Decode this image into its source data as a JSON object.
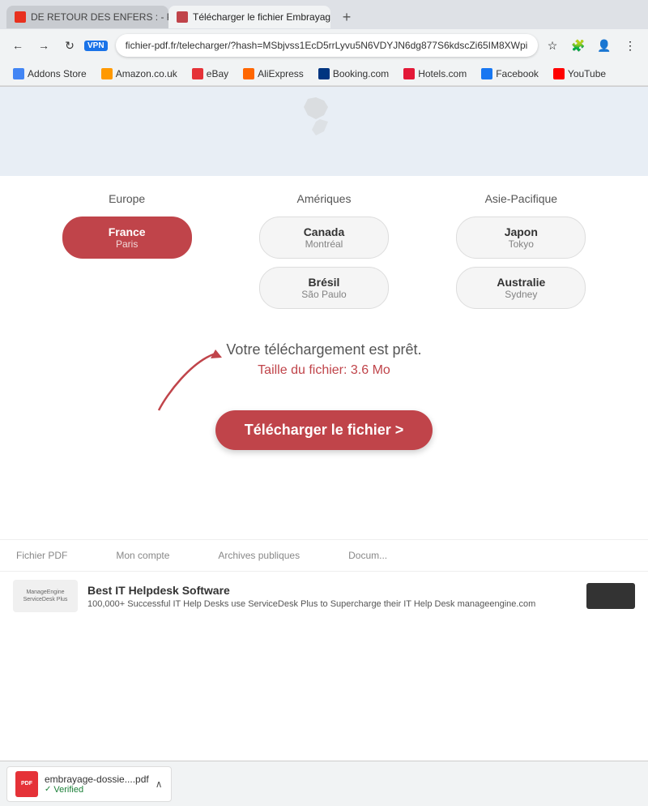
{
  "browser": {
    "tabs": [
      {
        "id": "tab1",
        "title": "DE RETOUR DES ENFERS : - Page...",
        "active": false,
        "favicon_color": "#e8301e"
      },
      {
        "id": "tab2",
        "title": "Télécharger le fichier Embrayage",
        "active": true,
        "favicon_color": "#c0444a"
      }
    ],
    "new_tab_icon": "+",
    "address_bar": {
      "value": "fichier-pdf.fr/telecharger/?hash=MSbjvss1EcD5rrLyvu5N6VDYJN6dg877S6kdscZi65IM8XWpi...",
      "vpn_label": "VPN"
    },
    "nav_buttons": {
      "back": "←",
      "forward": "→",
      "refresh": "↻",
      "home": ""
    },
    "bookmarks": [
      {
        "label": "Addons Store",
        "fav_class": "fav-addons"
      },
      {
        "label": "Amazon.co.uk",
        "fav_class": "fav-amazon"
      },
      {
        "label": "eBay",
        "fav_class": "fav-ebay"
      },
      {
        "label": "AliExpress",
        "fav_class": "fav-ali"
      },
      {
        "label": "Booking.com",
        "fav_class": "fav-booking"
      },
      {
        "label": "Hotels.com",
        "fav_class": "fav-hotels"
      },
      {
        "label": "Facebook",
        "fav_class": "fav-facebook"
      },
      {
        "label": "YouTube",
        "fav_class": "fav-youtube"
      }
    ]
  },
  "page": {
    "regions": {
      "europe": {
        "header": "Europe",
        "servers": [
          {
            "city": "France",
            "sub": "Paris",
            "active": true
          }
        ]
      },
      "ameriques": {
        "header": "Amériques",
        "servers": [
          {
            "city": "Canada",
            "sub": "Montréal",
            "active": false
          },
          {
            "city": "Brésil",
            "sub": "São Paulo",
            "active": false
          }
        ]
      },
      "asie": {
        "header": "Asie-Pacifique",
        "servers": [
          {
            "city": "Japon",
            "sub": "Tokyo",
            "active": false
          },
          {
            "city": "Australie",
            "sub": "Sydney",
            "active": false
          }
        ]
      }
    },
    "download": {
      "ready_text": "Votre téléchargement est prêt.",
      "file_size_label": "Taille du fichier:",
      "file_size_value": "3.6 Mo",
      "button_label": "Télécharger le fichier >"
    },
    "footer_links": [
      "Fichier PDF",
      "Mon compte",
      "Archives publiques",
      "Docum..."
    ]
  },
  "ad": {
    "logo_text": "ManageEngine\nServiceDesk Plus",
    "title": "Best IT Helpdesk Software",
    "description": "100,000+ Successful IT Help Desks use ServiceDesk Plus to Supercharge their IT Help Desk manageengine.com",
    "cta_placeholder": ""
  },
  "download_bar": {
    "filename": "embrayage-dossie....pdf",
    "verified_label": "Verified",
    "checkmark": "✓"
  }
}
